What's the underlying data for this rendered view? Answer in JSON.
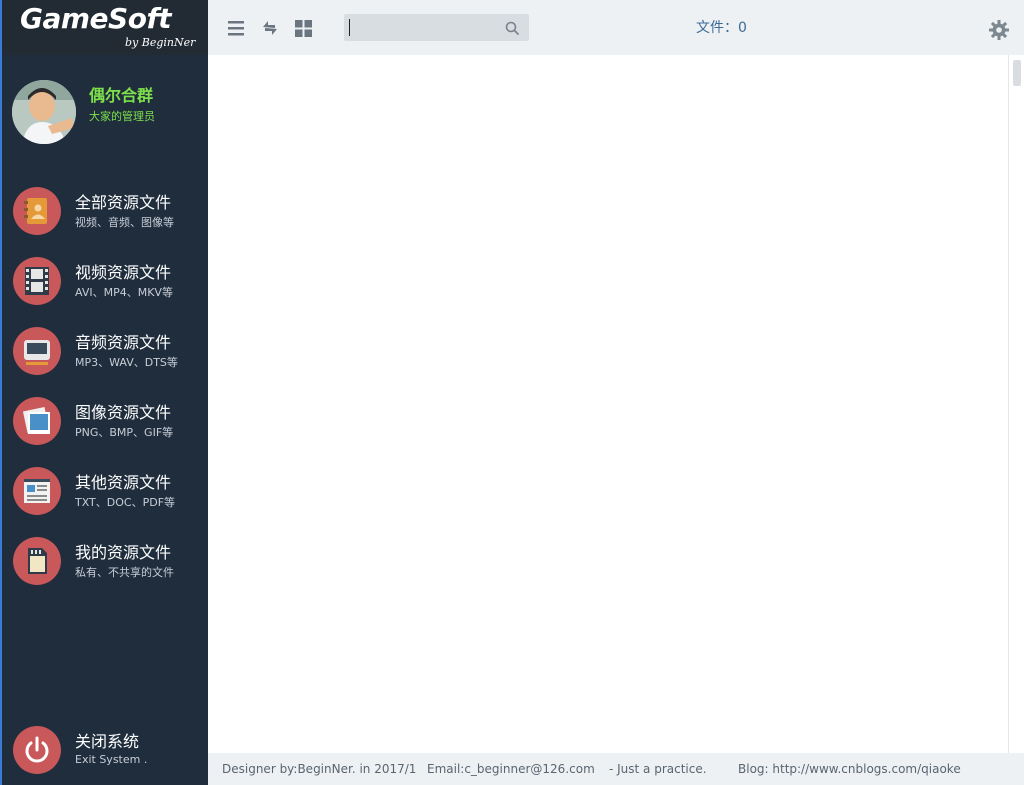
{
  "app": {
    "logo_main": "GameSoft",
    "logo_sub": "by BeginNer"
  },
  "profile": {
    "name": "偶尔合群",
    "role": "大家的管理员"
  },
  "nav": {
    "items": [
      {
        "title": "全部资源文件",
        "sub": "视频、音频、图像等",
        "icon": "contacts-book-icon"
      },
      {
        "title": "视频资源文件",
        "sub": "AVI、MP4、MKV等",
        "icon": "film-icon"
      },
      {
        "title": "音频资源文件",
        "sub": "MP3、WAV、DTS等",
        "icon": "audio-device-icon"
      },
      {
        "title": "图像资源文件",
        "sub": "PNG、BMP、GIF等",
        "icon": "photo-icon"
      },
      {
        "title": "其他资源文件",
        "sub": "TXT、DOC、PDF等",
        "icon": "document-icon"
      },
      {
        "title": "我的资源文件",
        "sub": "私有、不共享的文件",
        "icon": "sd-card-icon"
      }
    ],
    "exit": {
      "title": "关闭系统",
      "sub": "Exit System .",
      "icon": "power-icon"
    }
  },
  "toolbar": {
    "search_value": "",
    "file_count": "文件：0"
  },
  "footer": {
    "designer": "Designer by:BeginNer. in 2017/1",
    "email": "Email:c_beginner@126.com",
    "tagline": "- Just a practice.",
    "blog": "Blog: http://www.cnblogs.com/qiaoke"
  },
  "colors": {
    "sidebar_bg": "#1f2d3d",
    "icon_circle": "#c8585a",
    "accent_green": "#7ee04a",
    "topbar_bg": "#edf1f4",
    "file_count_text": "#3d6b97"
  }
}
